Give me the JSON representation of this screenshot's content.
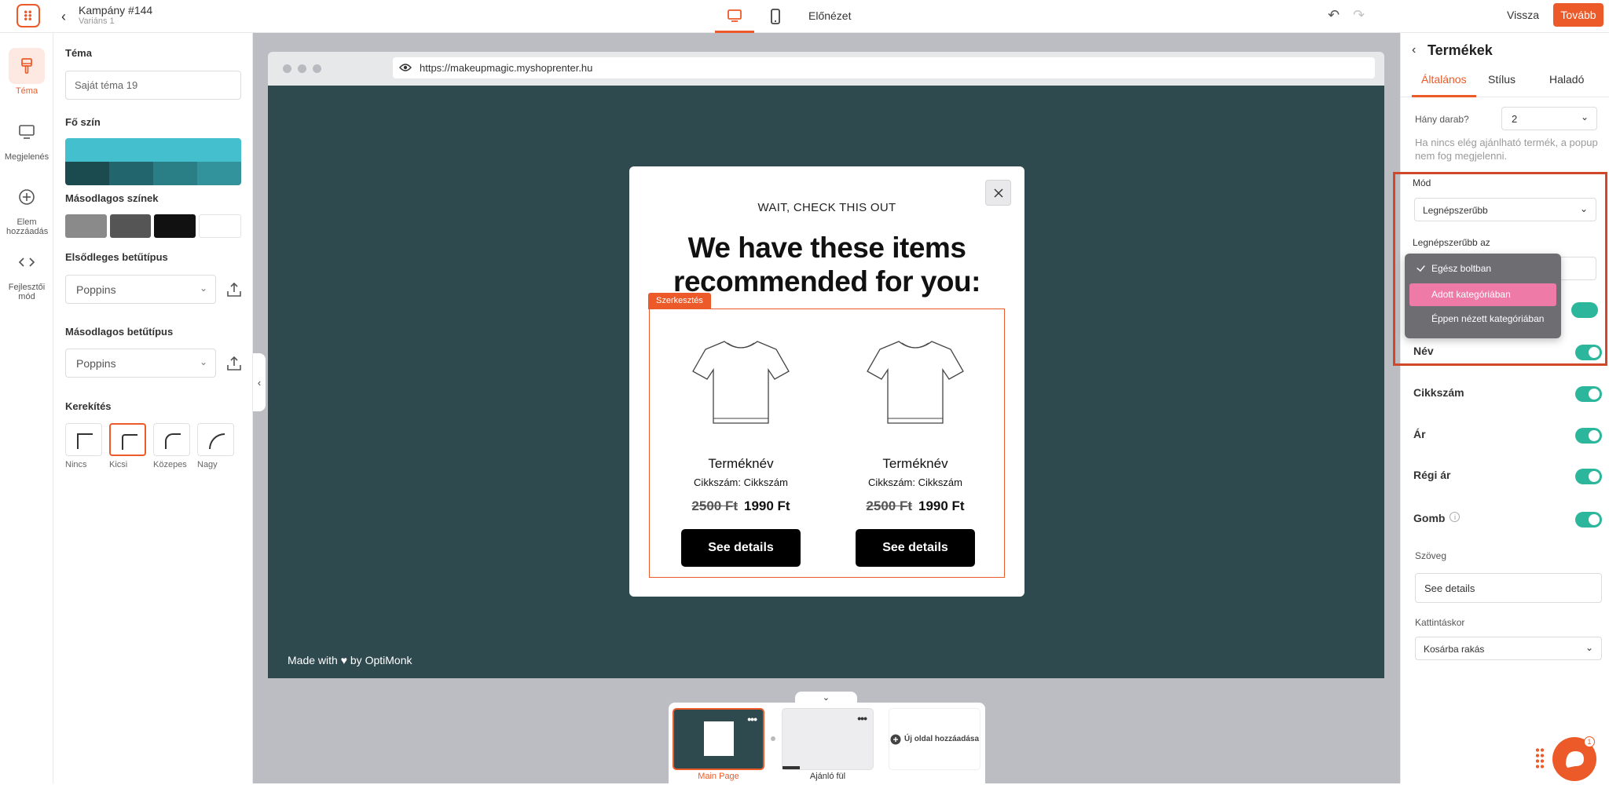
{
  "header": {
    "campaign_title": "Kampány #144",
    "variant": "Variáns 1",
    "preview_label": "Előnézet",
    "back_label": "Vissza",
    "next_label": "Tovább"
  },
  "rail": {
    "items": [
      {
        "label": "Téma",
        "icon": "brush-icon",
        "active": true
      },
      {
        "label": "Megjelenés",
        "icon": "monitor-icon"
      },
      {
        "label": "Elem hozzáadás",
        "icon": "plus-circle-icon"
      },
      {
        "label": "Fejlesztői mód",
        "icon": "code-icon"
      }
    ]
  },
  "theme": {
    "section_theme": "Téma",
    "theme_name": "Saját téma 19",
    "section_main_color": "Fő szín",
    "main_color": "#44bfcd",
    "main_shades": [
      "#1b4a4f",
      "#22656c",
      "#2a7f87",
      "#33939c"
    ],
    "section_secondary_colors": "Másodlagos színek",
    "secondary_colors": [
      "#8a8a8a",
      "#555555",
      "#111111",
      "#ffffff"
    ],
    "section_primary_font": "Elsődleges betűtípus",
    "primary_font": "Poppins",
    "section_secondary_font": "Másodlagos betűtípus",
    "secondary_font": "Poppins",
    "section_rounding": "Kerekítés",
    "rounding_options": [
      "Nincs",
      "Kicsi",
      "Közepes",
      "Nagy"
    ],
    "rounding_selected": "Kicsi"
  },
  "browser": {
    "url": "https://makeupmagic.myshoprenter.hu",
    "made_with": "Made with ♥ by OptiMonk"
  },
  "popup": {
    "kicker": "WAIT, CHECK THIS OUT",
    "headline_line1": "We have these items",
    "headline_line2": "recommended for you:",
    "edit_tag": "Szerkesztés",
    "products": [
      {
        "name": "Terméknév",
        "sku": "Cikkszám: Cikkszám",
        "old_price": "2500 Ft",
        "price": "1990 Ft",
        "button": "See details"
      },
      {
        "name": "Terméknév",
        "sku": "Cikkszám: Cikkszám",
        "old_price": "2500 Ft",
        "price": "1990 Ft",
        "button": "See details"
      }
    ]
  },
  "pages": {
    "items": [
      {
        "label": "Main Page",
        "active": true
      },
      {
        "label": "Ajánló fül"
      }
    ],
    "add_label": "Új oldal hozzáadása"
  },
  "right_panel": {
    "title": "Termékek",
    "tabs": [
      "Általános",
      "Stílus",
      "Haladó"
    ],
    "active_tab": "Általános",
    "count_label": "Hány darab?",
    "count_value": "2",
    "help_text": "Ha nincs elég ajánlható termék, a popup nem fog megjelenni.",
    "mode_label": "Mód",
    "mode_value": "Legnépszerűbb",
    "popular_in_label": "Legnépszerűbb az",
    "dropdown_options": [
      "Egész boltban",
      "Adott kategóriában",
      "Éppen nézett kategóriában"
    ],
    "dropdown_checked": "Egész boltban",
    "dropdown_highlighted": "Adott kategóriában",
    "toggles": [
      {
        "label": "Név",
        "on": true
      },
      {
        "label": "Cikkszám",
        "on": true
      },
      {
        "label": "Ár",
        "on": true
      },
      {
        "label": "Régi ár",
        "on": true
      },
      {
        "label": "Gomb",
        "on": true
      }
    ],
    "text_label": "Szöveg",
    "text_value": "See details",
    "on_click_label": "Kattintáskor",
    "on_click_value": "Kosárba rakás"
  },
  "chat": {
    "badge": "1"
  }
}
